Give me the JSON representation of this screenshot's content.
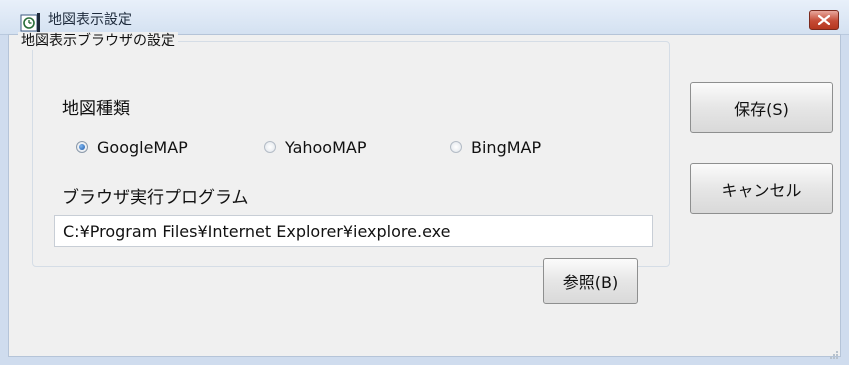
{
  "window": {
    "title": "地図表示設定",
    "icon": "clock-settings-icon",
    "close_icon": "close-icon"
  },
  "group": {
    "legend": "地図表示ブラウザの設定",
    "map_type_label": "地図種類",
    "map_options": [
      {
        "label": "GoogleMAP",
        "checked": true
      },
      {
        "label": "YahooMAP",
        "checked": false
      },
      {
        "label": "BingMAP",
        "checked": false
      }
    ],
    "browser_label": "ブラウザ実行プログラム",
    "browser_path": "C:¥Program Files¥Internet Explorer¥iexplore.exe",
    "browse_button": "参照(B)"
  },
  "buttons": {
    "save": "保存(S)",
    "cancel": "キャンセル"
  },
  "colors": {
    "close_button": "#c54b35",
    "radio_checked": "#1c58a8",
    "window_frame": "#cfdcee",
    "client_bg": "#f0f0f0"
  }
}
